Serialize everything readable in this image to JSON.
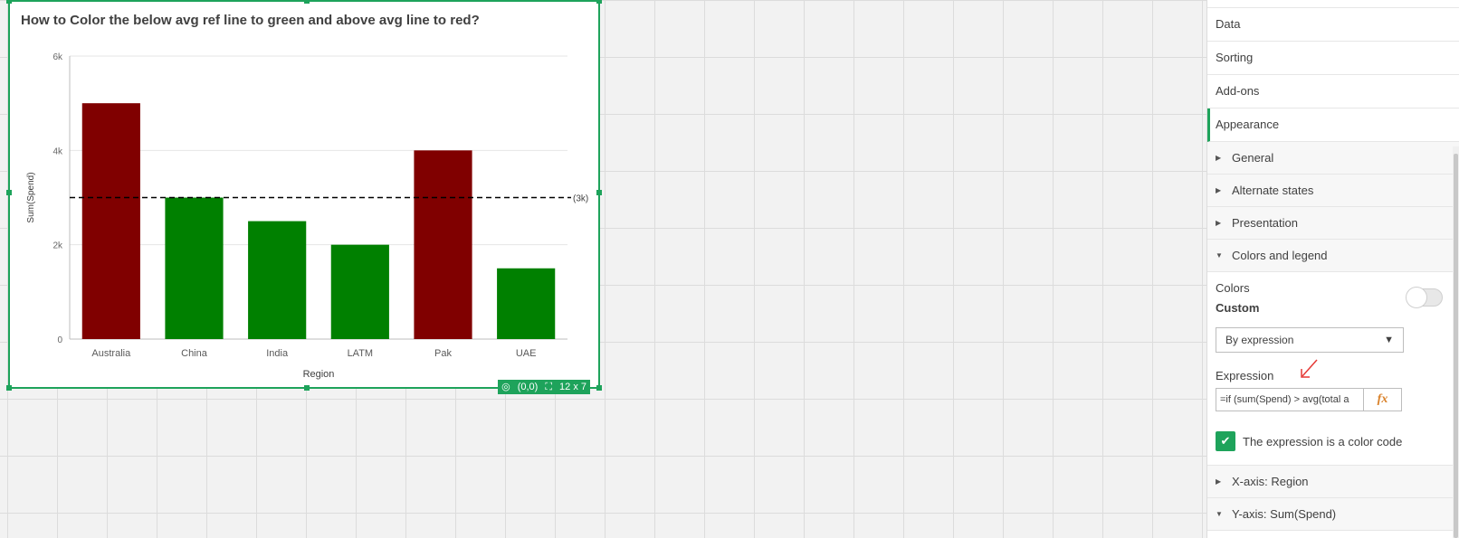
{
  "chart": {
    "title": "How to Color the below avg ref line to green and above avg line to red?",
    "footer_position": "(0,0)",
    "footer_size": "12 x 7"
  },
  "chart_data": {
    "type": "bar",
    "categories": [
      "Australia",
      "China",
      "India",
      "LATM",
      "Pak",
      "UAE"
    ],
    "values": [
      5000,
      3000,
      2500,
      2000,
      4000,
      1500
    ],
    "bar_colors": [
      "#800000",
      "#008000",
      "#008000",
      "#008000",
      "#800000",
      "#008000"
    ],
    "xlabel": "Region",
    "ylabel": "Sum(Spend)",
    "ylim": [
      0,
      6000
    ],
    "yticks": [
      0,
      2000,
      4000,
      6000
    ],
    "ytick_labels": [
      "0",
      "2k",
      "4k",
      "6k"
    ],
    "reference_line": {
      "value": 3000,
      "label": "(3k)",
      "style": "dashed",
      "color": "#000000"
    },
    "grid": true,
    "legend": "none"
  },
  "panel": {
    "tabs": [
      {
        "label": "Data"
      },
      {
        "label": "Sorting"
      },
      {
        "label": "Add-ons"
      },
      {
        "label": "Appearance",
        "active": true
      }
    ],
    "sections_top": [
      {
        "label": "General",
        "expanded": false
      },
      {
        "label": "Alternate states",
        "expanded": false
      },
      {
        "label": "Presentation",
        "expanded": false
      },
      {
        "label": "Colors and legend",
        "expanded": true
      }
    ],
    "colors": {
      "label": "Colors",
      "mode_label": "Custom",
      "dropdown_value": "By expression",
      "expression_label": "Expression",
      "expression_value": "=if (sum(Spend) > avg(total a",
      "fx_label": "fx",
      "checkbox_label": "The expression is a color code",
      "checkbox_checked": true
    },
    "sections_bottom": [
      {
        "label": "X-axis: Region",
        "expanded": false
      },
      {
        "label": "Y-axis: Sum(Spend)",
        "expanded": true
      }
    ]
  },
  "accent_color": "#1ea35b",
  "annotation_color": "#e53935"
}
